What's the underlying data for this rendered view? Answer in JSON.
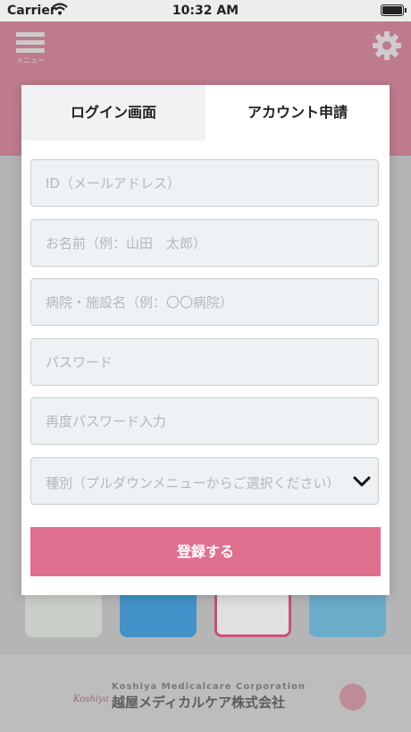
{
  "status_bar": {
    "carrier": "Carrier",
    "time": "10:32 AM"
  },
  "background": {
    "menu_label": "メニュー",
    "footer_company_en": "Koshiya Medicalcare Corporation",
    "footer_company_jp": "越屋メディカルケア株式会社",
    "footer_script": "Koshiya",
    "colors": {
      "header": "#d98c9f",
      "accent": "#e0708f"
    }
  },
  "modal": {
    "tabs": [
      {
        "label": "ログイン画面",
        "active": false
      },
      {
        "label": "アカウント申請",
        "active": true
      }
    ],
    "fields": {
      "email_placeholder": "ID（メールアドレス）",
      "name_placeholder": "お名前（例：山田　太郎）",
      "facility_placeholder": "病院・施設名（例：〇〇病院）",
      "password_placeholder": "パスワード",
      "password_confirm_placeholder": "再度パスワード入力",
      "category_placeholder": "種別（プルダウンメニューからご選択ください）"
    },
    "submit_label": "登録する"
  }
}
